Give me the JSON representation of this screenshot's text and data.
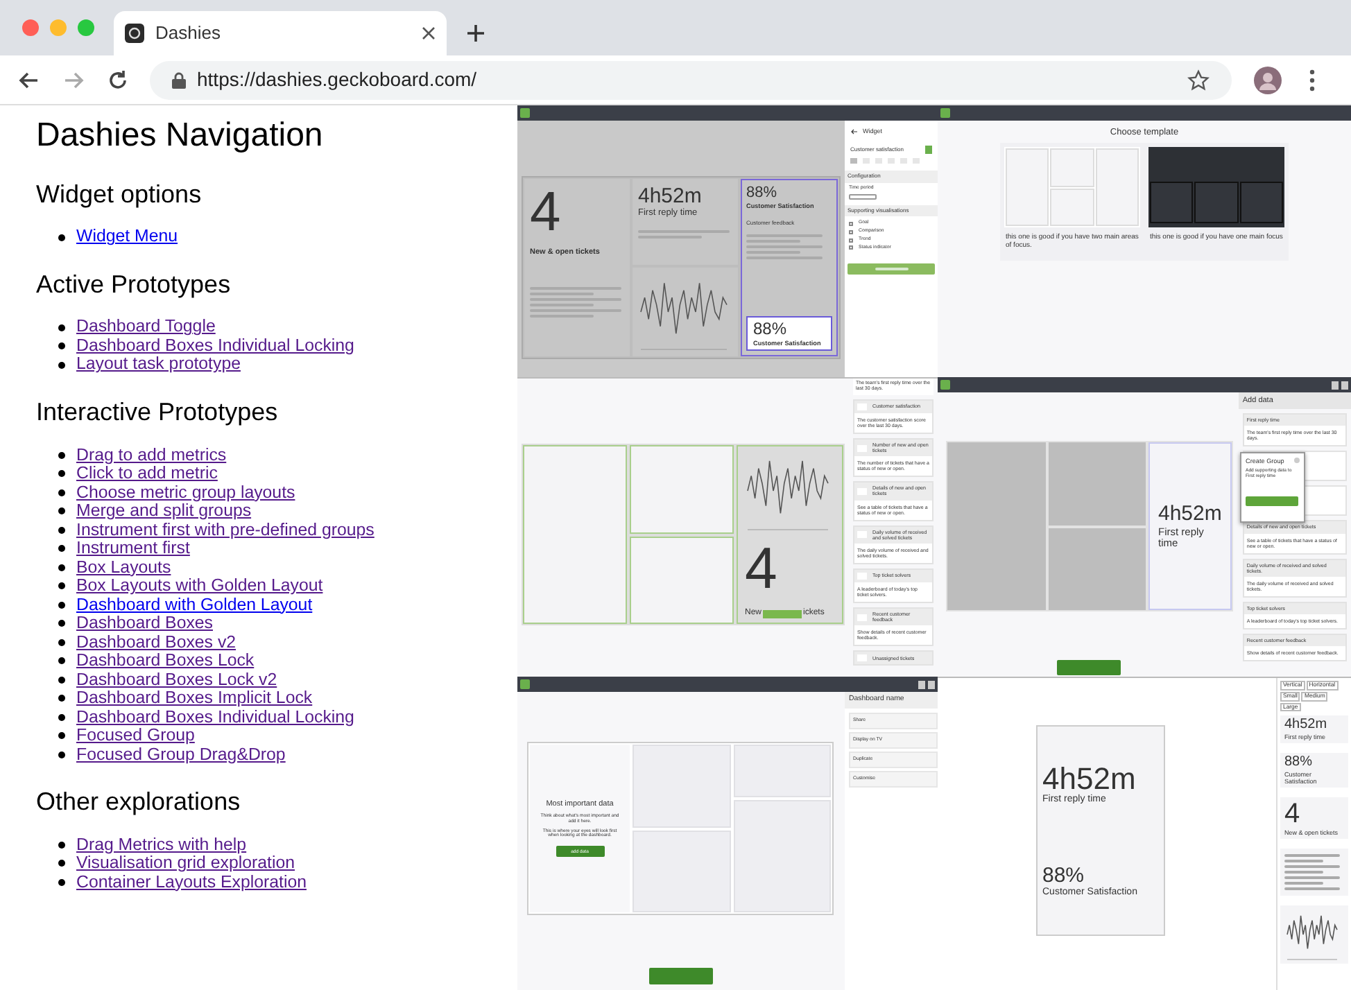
{
  "browser": {
    "tab": {
      "title": "Dashies",
      "selected": true
    },
    "nav_buttons": [
      {
        "kind": "back",
        "disabled": false
      },
      {
        "kind": "forward",
        "disabled": true
      },
      {
        "kind": "reload",
        "disabled": false
      }
    ],
    "url": "https://dashies.geckoboard.com/"
  },
  "nav": {
    "title": "Dashies Navigation",
    "sections": [
      {
        "heading": "Widget options",
        "links": [
          {
            "label": "Widget Menu",
            "visited": false
          }
        ]
      },
      {
        "heading": "Active Prototypes",
        "links": [
          {
            "label": "Dashboard Toggle",
            "visited": true
          },
          {
            "label": "Dashboard Boxes Individual Locking",
            "visited": true
          },
          {
            "label": "Layout task prototype",
            "visited": true
          }
        ]
      },
      {
        "heading": "Interactive Prototypes",
        "links": [
          {
            "label": "Drag to add metrics",
            "visited": true
          },
          {
            "label": "Click to add metric",
            "visited": true
          },
          {
            "label": "Choose metric group layouts",
            "visited": true
          },
          {
            "label": "Merge and split groups",
            "visited": true
          },
          {
            "label": "Instrument first with pre-defined groups",
            "visited": true
          },
          {
            "label": "Instrument first",
            "visited": true
          },
          {
            "label": "Box Layouts",
            "visited": true
          },
          {
            "label": "Box Layouts with Golden Layout",
            "visited": true
          },
          {
            "label": "Dashboard with Golden Layout",
            "visited": false
          },
          {
            "label": "Dashboard Boxes",
            "visited": true
          },
          {
            "label": "Dashboard Boxes v2",
            "visited": true
          },
          {
            "label": "Dashboard Boxes Lock",
            "visited": true
          },
          {
            "label": "Dashboard Boxes Lock v2",
            "visited": true
          },
          {
            "label": "Dashboard Boxes Implicit Lock",
            "visited": true
          },
          {
            "label": "Dashboard Boxes Individual Locking",
            "visited": true
          },
          {
            "label": "Focused Group",
            "visited": true
          },
          {
            "label": "Focused Group Drag&Drop",
            "visited": true
          }
        ]
      },
      {
        "heading": "Other explorations",
        "links": [
          {
            "label": "Drag Metrics with help",
            "visited": true
          },
          {
            "label": "Visualisation grid exploration",
            "visited": true
          },
          {
            "label": "Container Layouts Exploration",
            "visited": true
          }
        ]
      }
    ]
  },
  "previews": [
    {
      "kind": "widget-editor",
      "tiles": {
        "big_value": "4",
        "big_label": "New & open tickets",
        "time_value": "4h52m",
        "time_label": "First reply time",
        "score_value": "88%",
        "score_label": "Customer Satisfaction",
        "feedback_title": "Customer feedback",
        "card_value": "88%",
        "card_label": "Customer Satisfaction"
      },
      "sidebar": {
        "back": "Widget",
        "title": "Customer satisfaction",
        "config_heading": "Configuration",
        "field_label": "Time period",
        "vis_heading": "Supporting visualisations",
        "options": [
          {
            "label": "Goal",
            "checked": false
          },
          {
            "label": "Comparison",
            "checked": false
          },
          {
            "label": "Trend",
            "checked": false
          },
          {
            "label": "Status indicator",
            "checked": false
          }
        ]
      }
    },
    {
      "kind": "template-chooser",
      "title": "Choose template",
      "templates": [
        {
          "kind": "light",
          "caption": "this one is good if you have two main areas of focus."
        },
        {
          "kind": "dark",
          "caption": "this one is good if you have one main focus"
        }
      ]
    },
    {
      "kind": "add-data",
      "top_note": "The team's first reply time over the last 30 days.",
      "tile_value": "4",
      "tile_label_parts": [
        "New",
        "ickets"
      ],
      "metrics": [
        {
          "title": "Customer satisfaction",
          "description": "The customer satisfaction score over the last 30 days."
        },
        {
          "title": "Number of new and open tickets",
          "description": "The number of tickets that have a status of new or open."
        },
        {
          "title": "Details of new and open tickets",
          "description": "See a table of tickets that have a status of new or open."
        },
        {
          "title": "Daily volume of received and solved tickets",
          "description": "The daily volume of received and solved tickets."
        },
        {
          "title": "Top ticket solvers",
          "description": "A leaderboard of today's top ticket solvers."
        },
        {
          "title": "Recent customer feedback",
          "description": "Show details of recent customer feedback."
        },
        {
          "title": "Unassigned tickets"
        }
      ]
    },
    {
      "kind": "create-group",
      "panel_title": "Add data",
      "tile_value": "4h52m",
      "tile_label": "First reply time",
      "popup": {
        "title": "Create Group",
        "text": "Add supporting data to First reply time"
      },
      "metrics": [
        {
          "title": "First reply time",
          "description": "The team's first reply time over the last 30 days."
        },
        {
          "title": "Details of new and open tickets",
          "description": "See a table of tickets that have a status of new or open."
        },
        {
          "title": "Daily volume of received and solved tickets.",
          "description": "The daily volume of received and solved tickets."
        },
        {
          "title": "Top ticket solvers",
          "description": "A leaderboard of today's top ticket solvers."
        },
        {
          "title": "Recent customer feedback",
          "description": "Show details of recent customer feedback."
        }
      ]
    },
    {
      "kind": "dashboard-setup",
      "focus": {
        "title": "Most important data",
        "texts": [
          "Think about what's most important and add it here.",
          "This is where your eyes will look first when looking at the dashboard."
        ],
        "button": "add data"
      },
      "sidebar": {
        "title": "Dashboard name",
        "items": [
          "Share",
          "Display on TV",
          "Duplicate",
          "Customise"
        ]
      }
    },
    {
      "kind": "group-preview",
      "group": [
        {
          "value": "4h52m",
          "label": "First reply time"
        },
        {
          "value": "88%",
          "label": "Customer Satisfaction"
        }
      ],
      "toggles": [
        "Vertical",
        "Horizontal",
        "Small",
        "Medium",
        "Large"
      ],
      "tiles": [
        {
          "kind": "number",
          "value": "4h52m",
          "label": "First reply time"
        },
        {
          "kind": "number",
          "value": "88%",
          "label": "Customer Satisfaction"
        },
        {
          "kind": "number",
          "value": "4",
          "label": "New & open tickets"
        },
        {
          "kind": "table"
        },
        {
          "kind": "chart"
        }
      ]
    }
  ]
}
